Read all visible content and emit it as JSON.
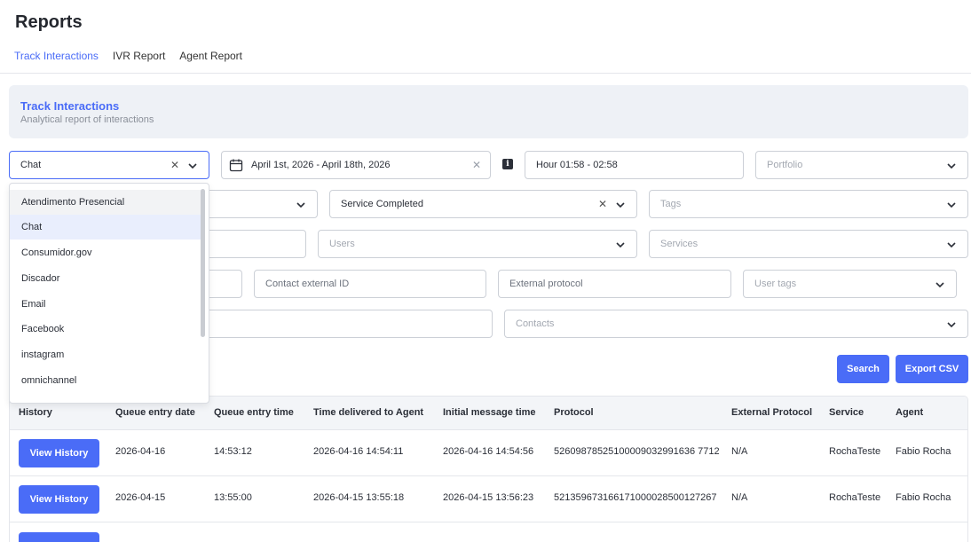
{
  "page": {
    "title": "Reports"
  },
  "tabs": [
    {
      "label": "Track Interactions",
      "active": true
    },
    {
      "label": "IVR Report",
      "active": false
    },
    {
      "label": "Agent Report",
      "active": false
    }
  ],
  "banner": {
    "title": "Track Interactions",
    "subtitle": "Analytical report of interactions"
  },
  "filters": {
    "channel": {
      "value": "Chat"
    },
    "date_range": {
      "value": "April 1st, 2026 - April 18th, 2026"
    },
    "hour": {
      "value": "Hour 01:58 - 02:58"
    },
    "portfolio": {
      "placeholder": "Portfolio"
    },
    "status": {
      "value": "Service Completed"
    },
    "tags": {
      "placeholder": "Tags"
    },
    "users": {
      "placeholder": "Users"
    },
    "services": {
      "placeholder": "Services"
    },
    "contact_external_id": {
      "placeholder": "Contact external ID"
    },
    "external_protocol": {
      "placeholder": "External protocol"
    },
    "user_tags": {
      "placeholder": "User tags"
    },
    "contacts": {
      "placeholder": "Contacts"
    }
  },
  "buttons": {
    "search": "Search",
    "export": "Export CSV"
  },
  "channel_dropdown": {
    "options": [
      "Atendimento Presencial",
      "Chat",
      "Consumidor.gov",
      "Discador",
      "Email",
      "Facebook",
      "instagram",
      "omnichannel"
    ]
  },
  "table": {
    "headers": [
      "History",
      "Queue entry date",
      "Queue entry time",
      "Time delivered to Agent",
      "Initial message time",
      "Protocol",
      "External Protocol",
      "Service",
      "Agent"
    ],
    "view_label": "View History",
    "rows": [
      {
        "date": "2026-04-16",
        "time": "14:53:12",
        "delivered": "2026-04-16 14:54:11",
        "initial": "2026-04-16 14:54:56",
        "protocol": "52609878525100009032991636 7712",
        "ext": "N/A",
        "service": "RochaTeste",
        "agent": "Fabio Rocha"
      },
      {
        "date": "2026-04-15",
        "time": "13:55:00",
        "delivered": "2026-04-15 13:55:18",
        "initial": "2026-04-15 13:56:23",
        "protocol": "521359673166171000028500127267",
        "ext": "N/A",
        "service": "RochaTeste",
        "agent": "Fabio Rocha"
      }
    ]
  },
  "colors": {
    "accent": "#4a6cf7",
    "banner_bg": "#eef1f6",
    "border": "#ccd0d7"
  }
}
